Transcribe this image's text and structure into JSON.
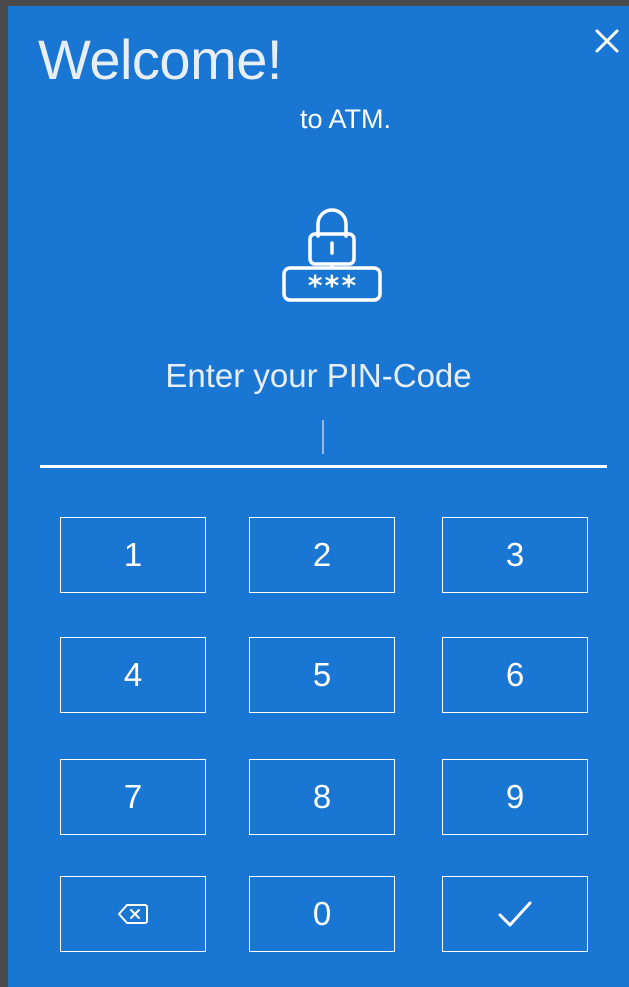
{
  "header": {
    "title": "Welcome!",
    "subtitle": "to ATM."
  },
  "icons": {
    "close": "close-icon",
    "lock": "lock-pin-icon",
    "backspace": "backspace-icon",
    "confirm": "checkmark-icon"
  },
  "prompt": "Enter your PIN-Code",
  "pin_input": {
    "value": ""
  },
  "keypad": {
    "keys": [
      "1",
      "2",
      "3",
      "4",
      "5",
      "6",
      "7",
      "8",
      "9",
      "0"
    ]
  },
  "colors": {
    "background": "#1976D2",
    "foreground": "#FFFFFF",
    "window_border": "#4A4A4A"
  }
}
